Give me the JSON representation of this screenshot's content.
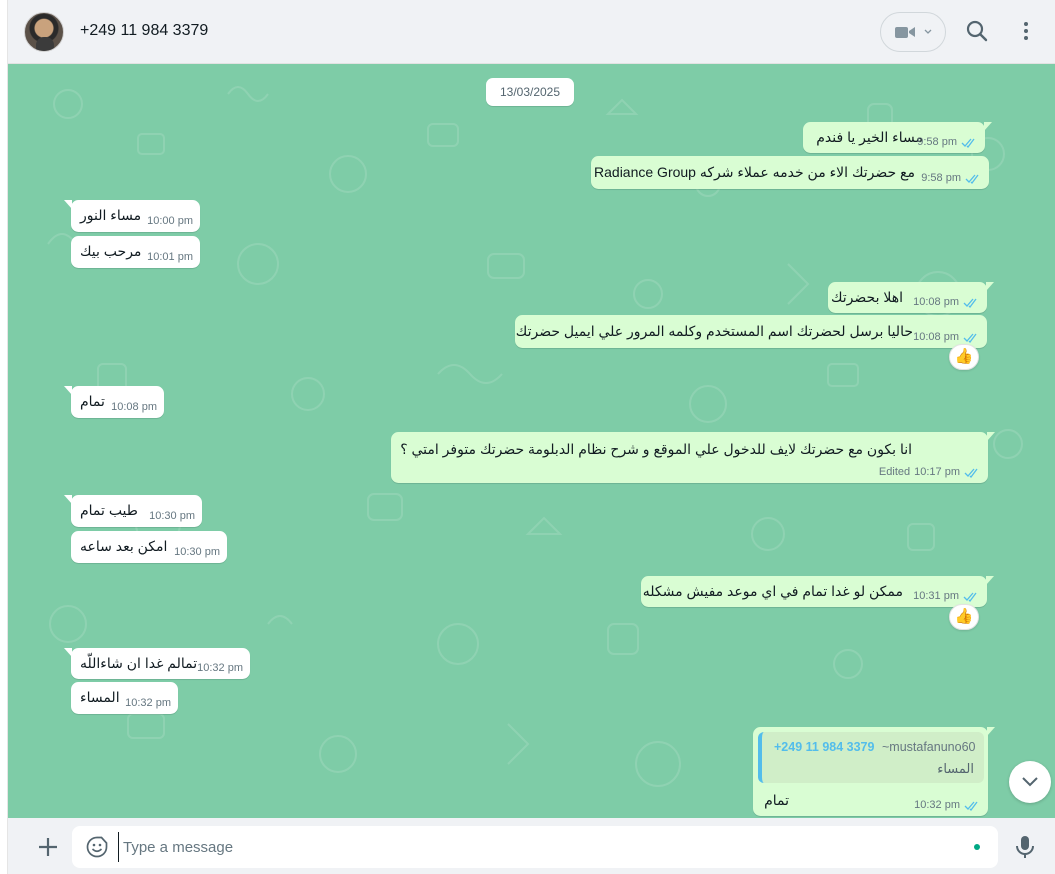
{
  "header": {
    "contact_name": "+249 11 984 3379"
  },
  "chat": {
    "date_chip": "13/03/2025",
    "messages": [
      {
        "dir": "out",
        "text": "مساء الخير يا فندم",
        "time": "9:58 pm"
      },
      {
        "dir": "out",
        "text": "مع حضرتك الاء  من خدمه عملاء شركه Radiance Group",
        "time": "9:58 pm"
      },
      {
        "dir": "in",
        "text": "مساء النور",
        "time": "10:00 pm"
      },
      {
        "dir": "in",
        "text": "مرحب بيك",
        "time": "10:01 pm"
      },
      {
        "dir": "out",
        "text": "اهلا بحضرتك",
        "time": "10:08 pm"
      },
      {
        "dir": "out",
        "text": "حاليا برسل لحضرتك اسم المستخدم وكلمه المرور علي ايميل حضرتك",
        "time": "10:08 pm",
        "reaction": "👍"
      },
      {
        "dir": "in",
        "text": "تمام",
        "time": "10:08 pm"
      },
      {
        "dir": "out",
        "text": "انا بكون مع حضرتك لايف للدخول علي الموقع و شرح نظام الدبلومة حضرتك متوفر امتي ؟",
        "time": "10:17 pm",
        "edited": "Edited"
      },
      {
        "dir": "in",
        "text": "طيب تمام",
        "time": "10:30 pm"
      },
      {
        "dir": "in",
        "text": "امكن بعد ساعه",
        "time": "10:30 pm"
      },
      {
        "dir": "out",
        "text": "ممكن لو غدا تمام في اي موعد مفيش مشكله",
        "time": "10:31 pm",
        "reaction": "👍"
      },
      {
        "dir": "in",
        "text": "تمالم غدا ان شاءاللّه",
        "time": "10:32 pm"
      },
      {
        "dir": "in",
        "text": "المساء",
        "time": "10:32 pm"
      },
      {
        "dir": "out",
        "text": "تمام",
        "time": "10:32 pm",
        "quote": {
          "name": "+249 11 984 3379",
          "handle": "~mustafanuno60",
          "text": "المساء"
        }
      }
    ]
  },
  "composer": {
    "placeholder": "Type a message"
  },
  "colors": {
    "chat_bg": "#7ecca7",
    "outgoing": "#d9fdd3",
    "incoming": "#ffffff",
    "read_ticks": "#53bdeb",
    "accent": "#00a884"
  }
}
